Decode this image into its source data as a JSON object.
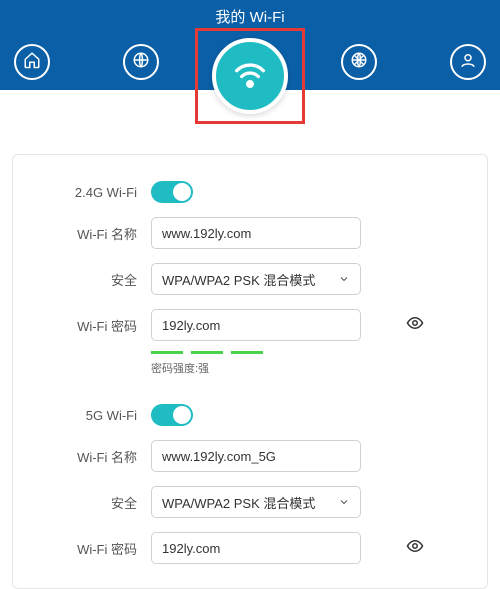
{
  "title": "我的 Wi-Fi",
  "nav": {
    "home": "home-icon",
    "globe1": "globe-icon",
    "wifi": "wifi-icon",
    "globe2": "globe-settings-icon",
    "user": "user-icon"
  },
  "wifi24": {
    "toggle_label": "2.4G Wi-Fi",
    "toggle_on": true,
    "name_label": "Wi-Fi 名称",
    "name_value": "www.192ly.com",
    "security_label": "安全",
    "security_value": "WPA/WPA2 PSK 混合模式",
    "password_label": "Wi-Fi 密码",
    "password_value": "192ly.com",
    "strength_label": "密码强度:强"
  },
  "wifi5": {
    "toggle_label": "5G Wi-Fi",
    "toggle_on": true,
    "name_label": "Wi-Fi 名称",
    "name_value": "www.192ly.com_5G",
    "security_label": "安全",
    "security_value": "WPA/WPA2 PSK 混合模式",
    "password_label": "Wi-Fi 密码",
    "password_value": "192ly.com"
  }
}
